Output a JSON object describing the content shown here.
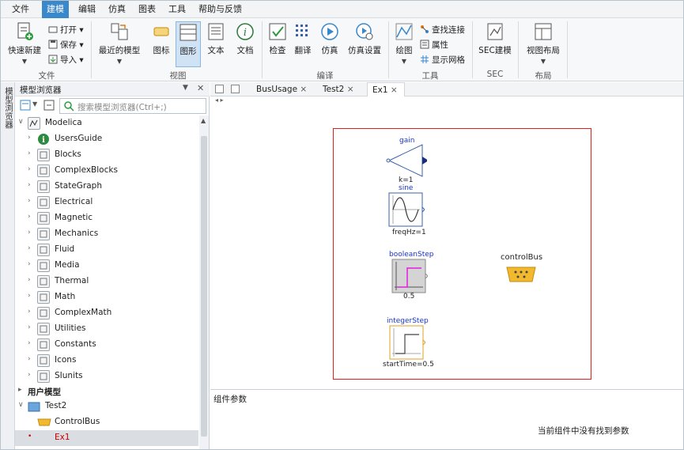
{
  "menu": [
    "文件",
    "建模",
    "编辑",
    "仿真",
    "图表",
    "工具",
    "帮助与反馈"
  ],
  "menu_active_index": 1,
  "ribbon": {
    "file_group": {
      "label": "文件",
      "quick_new": "快速新建",
      "open": "打开",
      "save": "保存",
      "import": "导入"
    },
    "view_group": {
      "label": "视图",
      "recent_models": "最近的模型",
      "icon": "图标",
      "diagram": "图形",
      "text": "文本",
      "doc": "文档"
    },
    "compile_group": {
      "label": "编译",
      "check": "检查",
      "translate": "翻译",
      "simulate": "仿真",
      "sim_settings": "仿真设置"
    },
    "tools_group": {
      "label": "工具",
      "draw": "绘图",
      "find_connection": "查找连接",
      "properties": "属性",
      "show_grid": "显示网格"
    },
    "sec_group": {
      "label": "SEC",
      "sec_modeling": "SEC建模"
    },
    "layout_group": {
      "label": "布局",
      "view_layout": "视图布局"
    }
  },
  "vertical_tab": "模型浏览器",
  "browser": {
    "title": "模型浏览器",
    "search_placeholder": "搜索模型浏览器(Ctrl+;)",
    "root": "Modelica",
    "items": [
      "UsersGuide",
      "Blocks",
      "ComplexBlocks",
      "StateGraph",
      "Electrical",
      "Magnetic",
      "Mechanics",
      "Fluid",
      "Media",
      "Thermal",
      "Math",
      "ComplexMath",
      "Utilities",
      "Constants",
      "Icons",
      "SIunits"
    ],
    "user_models_label": "用户模型",
    "user_root": "Test2",
    "user_items": [
      "ControlBus",
      "Ex1"
    ]
  },
  "tabs": [
    "BusUsage",
    "Test2",
    "Ex1"
  ],
  "active_tab_index": 2,
  "canvas": {
    "gain_label": "gain",
    "gain_param": "k=1",
    "sine_label": "sine",
    "sine_param": "freqHz=1",
    "boolean_label": "booleanStep",
    "boolean_param": "0.5",
    "integer_label": "integerStep",
    "integer_param": "startTime=0.5",
    "controlbus_label": "controlBus"
  },
  "params": {
    "title": "组件参数",
    "empty_message": "当前组件中没有找到参数"
  },
  "colors": {
    "accent": "#3a87c9",
    "frame": "#e02020",
    "component_label": "#1a33cc",
    "bus": "#f2b92e"
  }
}
